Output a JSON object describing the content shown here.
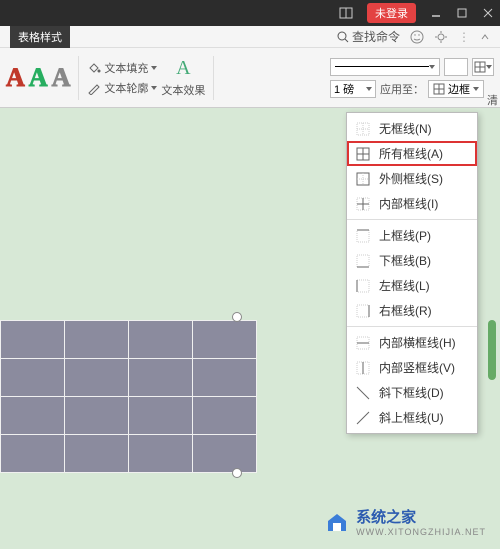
{
  "titlebar": {
    "login": "未登录"
  },
  "ribbon": {
    "active_tab": "表格样式",
    "search_placeholder": "查找命令"
  },
  "toolbar": {
    "text_fill": "文本填充",
    "text_outline": "文本轮廓",
    "text_effect": "文本效果",
    "line_size": "1 磅",
    "apply_to": "应用至：",
    "border_btn": "边框",
    "clear": "清"
  },
  "dropdown": {
    "items": [
      {
        "icon": "no-border",
        "label": "无框线(N)"
      },
      {
        "icon": "all-border",
        "label": "所有框线(A)",
        "selected": true
      },
      {
        "icon": "outer-border",
        "label": "外侧框线(S)"
      },
      {
        "icon": "inner-border",
        "label": "内部框线(I)"
      },
      {
        "sep": true
      },
      {
        "icon": "top-border",
        "label": "上框线(P)"
      },
      {
        "icon": "bottom-border",
        "label": "下框线(B)"
      },
      {
        "icon": "left-border",
        "label": "左框线(L)"
      },
      {
        "icon": "right-border",
        "label": "右框线(R)"
      },
      {
        "sep": true
      },
      {
        "icon": "inner-h",
        "label": "内部横框线(H)"
      },
      {
        "icon": "inner-v",
        "label": "内部竖框线(V)"
      },
      {
        "icon": "diag-down",
        "label": "斜下框线(D)"
      },
      {
        "icon": "diag-up",
        "label": "斜上框线(U)"
      }
    ]
  },
  "watermark": {
    "name": "系统之家",
    "url": "WWW.XITONGZHIJIA.NET"
  }
}
